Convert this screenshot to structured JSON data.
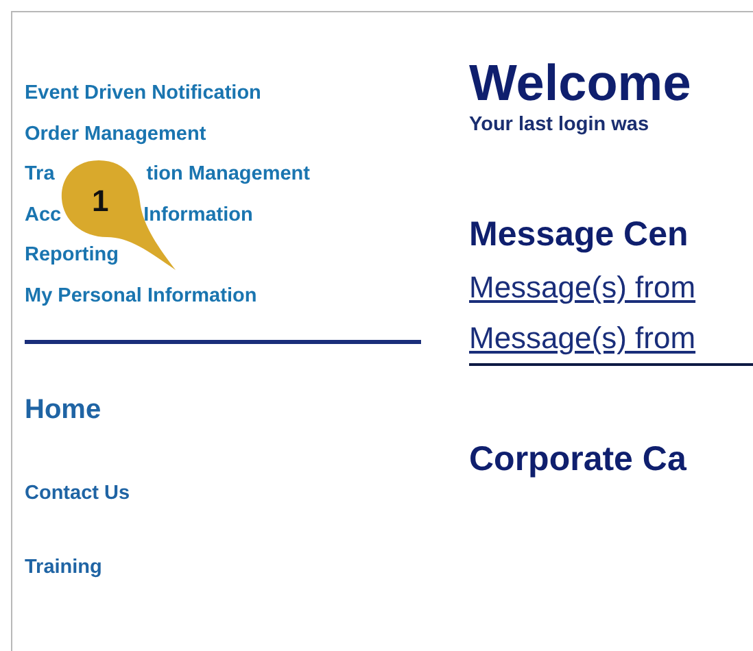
{
  "sidebar": {
    "items": [
      {
        "label": "Event Driven Notification"
      },
      {
        "label": "Order Management"
      },
      {
        "parts": [
          "Tra",
          "tion Management"
        ]
      },
      {
        "parts": [
          "Acc",
          "Information"
        ]
      },
      {
        "label": "Reporting"
      },
      {
        "label": "My Personal Information"
      }
    ],
    "home": "Home",
    "links": [
      {
        "label": "Contact Us"
      },
      {
        "label": "Training"
      }
    ]
  },
  "callout": {
    "number": "1"
  },
  "main": {
    "title": "Welcome",
    "subtitle": "Your last login was",
    "sections": [
      {
        "heading": "Message Cen",
        "links": [
          "Message(s) from",
          "Message(s) from"
        ]
      },
      {
        "heading": "Corporate Ca"
      }
    ]
  }
}
